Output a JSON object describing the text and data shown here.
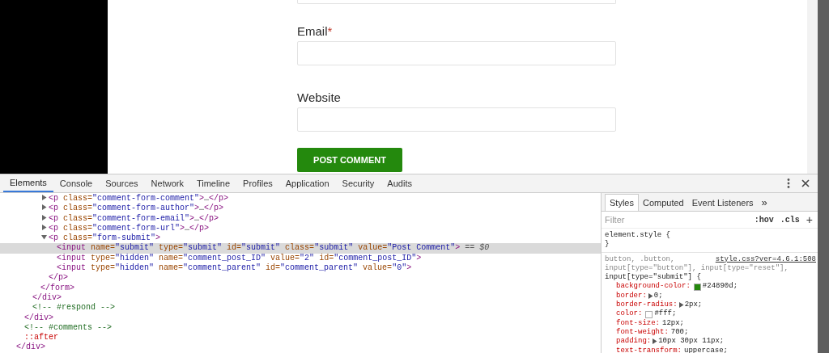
{
  "page": {
    "required_marker": "*",
    "fields": [
      {
        "label": "Email",
        "required": true
      },
      {
        "label": "Website",
        "required": false
      }
    ],
    "submit_button": "POST COMMENT"
  },
  "devtools": {
    "tabs": [
      {
        "label": "Elements",
        "selected": true
      },
      {
        "label": "Console",
        "selected": false
      },
      {
        "label": "Sources",
        "selected": false
      },
      {
        "label": "Network",
        "selected": false
      },
      {
        "label": "Timeline",
        "selected": false
      },
      {
        "label": "Profiles",
        "selected": false
      },
      {
        "label": "Application",
        "selected": false
      },
      {
        "label": "Security",
        "selected": false
      },
      {
        "label": "Audits",
        "selected": false
      }
    ],
    "dom": [
      {
        "children": [
          {
            "children": [
              {
                "children": [
                  {
                    "children": [
                      {
                        "selected": false,
                        "expanded": false,
                        "parts": [
                          {
                            "kind": "tag",
                            "text": "<p"
                          },
                          {
                            "kind": "attr",
                            "text": " class="
                          },
                          {
                            "kind": "val",
                            "text": "\"comment-form-comment\""
                          },
                          {
                            "kind": "tag",
                            "text": ">"
                          },
                          {
                            "kind": "text",
                            "text": "…"
                          },
                          {
                            "kind": "tag",
                            "text": "</p>"
                          }
                        ]
                      },
                      {
                        "selected": false,
                        "expanded": false,
                        "parts": [
                          {
                            "kind": "tag",
                            "text": "<p"
                          },
                          {
                            "kind": "attr",
                            "text": " class="
                          },
                          {
                            "kind": "val",
                            "text": "\"comment-form-author\""
                          },
                          {
                            "kind": "tag",
                            "text": ">"
                          },
                          {
                            "kind": "text",
                            "text": "…"
                          },
                          {
                            "kind": "tag",
                            "text": "</p>"
                          }
                        ]
                      },
                      {
                        "selected": false,
                        "expanded": false,
                        "parts": [
                          {
                            "kind": "tag",
                            "text": "<p"
                          },
                          {
                            "kind": "attr",
                            "text": " class="
                          },
                          {
                            "kind": "val",
                            "text": "\"comment-form-email\""
                          },
                          {
                            "kind": "tag",
                            "text": ">"
                          },
                          {
                            "kind": "text",
                            "text": "…"
                          },
                          {
                            "kind": "tag",
                            "text": "</p>"
                          }
                        ]
                      },
                      {
                        "selected": false,
                        "expanded": false,
                        "parts": [
                          {
                            "kind": "tag",
                            "text": "<p"
                          },
                          {
                            "kind": "attr",
                            "text": " class="
                          },
                          {
                            "kind": "val",
                            "text": "\"comment-form-url\""
                          },
                          {
                            "kind": "tag",
                            "text": ">"
                          },
                          {
                            "kind": "text",
                            "text": "…"
                          },
                          {
                            "kind": "tag",
                            "text": "</p>"
                          }
                        ]
                      },
                      {
                        "selected": false,
                        "expanded": true,
                        "parts": [
                          {
                            "kind": "tag",
                            "text": "<p"
                          },
                          {
                            "kind": "attr",
                            "text": " class="
                          },
                          {
                            "kind": "val",
                            "text": "\"form-submit\""
                          },
                          {
                            "kind": "tag",
                            "text": ">"
                          }
                        ],
                        "children": [
                          {
                            "selected": true,
                            "parts": [
                              {
                                "kind": "tag",
                                "text": "<input"
                              },
                              {
                                "kind": "attr",
                                "text": " name="
                              },
                              {
                                "kind": "val",
                                "text": "\"submit\""
                              },
                              {
                                "kind": "attr",
                                "text": " type="
                              },
                              {
                                "kind": "val",
                                "text": "\"submit\""
                              },
                              {
                                "kind": "attr",
                                "text": " id="
                              },
                              {
                                "kind": "val",
                                "text": "\"submit\""
                              },
                              {
                                "kind": "attr",
                                "text": " class="
                              },
                              {
                                "kind": "val",
                                "text": "\"submit\""
                              },
                              {
                                "kind": "attr",
                                "text": " value="
                              },
                              {
                                "kind": "val",
                                "text": "\"Post Comment\""
                              },
                              {
                                "kind": "tag",
                                "text": ">"
                              },
                              {
                                "kind": "ref",
                                "text": " == $0"
                              }
                            ]
                          },
                          {
                            "selected": false,
                            "parts": [
                              {
                                "kind": "tag",
                                "text": "<input"
                              },
                              {
                                "kind": "attr",
                                "text": " type="
                              },
                              {
                                "kind": "val",
                                "text": "\"hidden\""
                              },
                              {
                                "kind": "attr",
                                "text": " name="
                              },
                              {
                                "kind": "val",
                                "text": "\"comment_post_ID\""
                              },
                              {
                                "kind": "attr",
                                "text": " value="
                              },
                              {
                                "kind": "val",
                                "text": "\"2\""
                              },
                              {
                                "kind": "attr",
                                "text": " id="
                              },
                              {
                                "kind": "val",
                                "text": "\"comment_post_ID\""
                              },
                              {
                                "kind": "tag",
                                "text": ">"
                              }
                            ]
                          },
                          {
                            "selected": false,
                            "parts": [
                              {
                                "kind": "tag",
                                "text": "<input"
                              },
                              {
                                "kind": "attr",
                                "text": " type="
                              },
                              {
                                "kind": "val",
                                "text": "\"hidden\""
                              },
                              {
                                "kind": "attr",
                                "text": " name="
                              },
                              {
                                "kind": "val",
                                "text": "\"comment_parent\""
                              },
                              {
                                "kind": "attr",
                                "text": " id="
                              },
                              {
                                "kind": "val",
                                "text": "\"comment_parent\""
                              },
                              {
                                "kind": "attr",
                                "text": " value="
                              },
                              {
                                "kind": "val",
                                "text": "\"0\""
                              },
                              {
                                "kind": "tag",
                                "text": ">"
                              }
                            ]
                          }
                        ]
                      },
                      {
                        "selected": false,
                        "parts": [
                          {
                            "kind": "tag",
                            "text": "</p>"
                          }
                        ]
                      }
                    ]
                  },
                  {
                    "selected": false,
                    "parts": [
                      {
                        "kind": "tag",
                        "text": "</form>"
                      }
                    ]
                  }
                ]
              },
              {
                "selected": false,
                "parts": [
                  {
                    "kind": "tag",
                    "text": "</div>"
                  }
                ]
              },
              {
                "selected": false,
                "parts": [
                  {
                    "kind": "comment",
                    "text": "<!-- #respond -->"
                  }
                ]
              }
            ]
          },
          {
            "selected": false,
            "parts": [
              {
                "kind": "tag",
                "text": "</div>"
              }
            ]
          },
          {
            "selected": false,
            "parts": [
              {
                "kind": "comment",
                "text": "<!-- #comments -->"
              }
            ]
          },
          {
            "selected": false,
            "parts": [
              {
                "kind": "pseudo",
                "text": "::after"
              }
            ]
          }
        ]
      },
      {
        "selected": false,
        "parts": [
          {
            "kind": "tag",
            "text": "</div>"
          }
        ]
      }
    ],
    "styles": {
      "tabs": [
        {
          "label": "Styles",
          "selected": true
        },
        {
          "label": "Computed",
          "selected": false
        },
        {
          "label": "Event Listeners",
          "selected": false
        }
      ],
      "more": "»",
      "filter_placeholder": "Filter",
      "hov": ":hov",
      "cls": ".cls",
      "add": "+",
      "rules": [
        {
          "selector_lines": [
            {
              "text": "element.style {",
              "matched": true
            }
          ],
          "close": "}"
        },
        {
          "selector_lines": [
            {
              "text": "button, .button,",
              "matched": false
            },
            {
              "text": "input[type=\"button\"], input[type=\"reset\"],",
              "matched": false
            },
            {
              "text": "input[type=\"submit\"] {",
              "matched": true
            }
          ],
          "source": "style.css?ver=4.6.1:508",
          "declarations": [
            {
              "kind": "color",
              "name": "background-color:",
              "value": "#24890d;",
              "color": "#24890d"
            },
            {
              "kind": "shorthand",
              "name": "border:",
              "value": "0;"
            },
            {
              "kind": "shorthand",
              "name": "border-radius:",
              "value": "2px;"
            },
            {
              "kind": "color",
              "name": "color:",
              "value": "#fff;",
              "color": "#ffffff"
            },
            {
              "kind": "plain",
              "name": "font-size:",
              "value": "12px;"
            },
            {
              "kind": "plain",
              "name": "font-weight:",
              "value": "700;"
            },
            {
              "kind": "shorthand",
              "name": "padding:",
              "value": "10px 30px 11px;"
            },
            {
              "kind": "plain",
              "name": "text-transform:",
              "value": "uppercase;"
            }
          ]
        }
      ]
    }
  }
}
